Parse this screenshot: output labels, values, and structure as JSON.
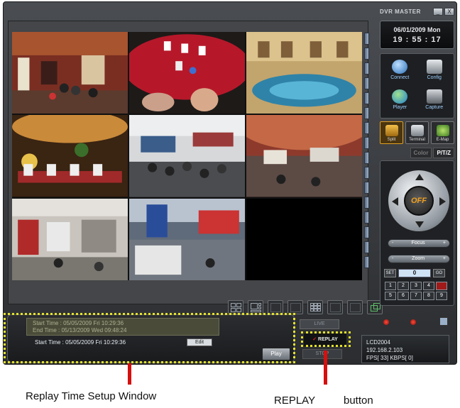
{
  "app": {
    "title": "DVR MASTER",
    "window_buttons": [
      "_",
      "X"
    ]
  },
  "clock": {
    "date": "06/01/2009 Mon",
    "time": "19 : 55 : 17"
  },
  "functions": [
    {
      "label": "Connect",
      "icon": "connect-icon",
      "color": "#6fa8dc"
    },
    {
      "label": "Config",
      "icon": "config-icon",
      "color": "#c0c6cc"
    },
    {
      "label": "Player",
      "icon": "player-icon",
      "color": "#4aa3e8"
    },
    {
      "label": "Capture",
      "icon": "capture-icon",
      "color": "#9aa2aa"
    }
  ],
  "modes": [
    {
      "label": "Split",
      "active": true
    },
    {
      "label": "Terminal",
      "active": false
    },
    {
      "label": "E-Map",
      "active": false
    }
  ],
  "ptz": {
    "tabs": [
      "Color",
      "P/T/Z"
    ],
    "center_label": "OFF",
    "focus_label": "Focus",
    "zoom_label": "Zoom",
    "set_label": "SET",
    "go_label": "GO",
    "display_value": "0",
    "keys": [
      "1",
      "2",
      "3",
      "4",
      "",
      "5",
      "6",
      "7",
      "8",
      "9"
    ]
  },
  "replay_setup": {
    "old_start": "Start Time : 05/05/2009 Fri 10:29:36",
    "old_end": "End Time : 05/13/2009 Wed 09:48:24",
    "start": "Start Time : 05/05/2009 Fri 10:29:36",
    "edit_label": "Edit",
    "play_label": "Play"
  },
  "replay_buttons": {
    "top_label": "LIVE",
    "replay_label": "REPLAY",
    "bottom_label": "STOP"
  },
  "network": {
    "name": "LCD2004",
    "ip": "192.168.2.103",
    "stats": "FPS[ 33] KBPS[ 0]"
  },
  "annotations": {
    "setup_caption": "Replay Time Setup Window",
    "replay_caption": "REPLAY",
    "replay_caption_suffix": "button",
    "marker_color": "#d60f0f",
    "highlight_color": "#e4e22a"
  },
  "camera_tiles": [
    {
      "name": "camera-1",
      "theme": "trade-hall"
    },
    {
      "name": "camera-2",
      "theme": "casino-table"
    },
    {
      "name": "camera-3",
      "theme": "pool-hall"
    },
    {
      "name": "camera-4",
      "theme": "slot-floor"
    },
    {
      "name": "camera-5",
      "theme": "expo-crowd"
    },
    {
      "name": "camera-6",
      "theme": "dome-hall"
    },
    {
      "name": "camera-7",
      "theme": "booth-row"
    },
    {
      "name": "camera-8",
      "theme": "booth-stand"
    },
    {
      "name": "camera-9",
      "theme": "no-signal"
    }
  ]
}
